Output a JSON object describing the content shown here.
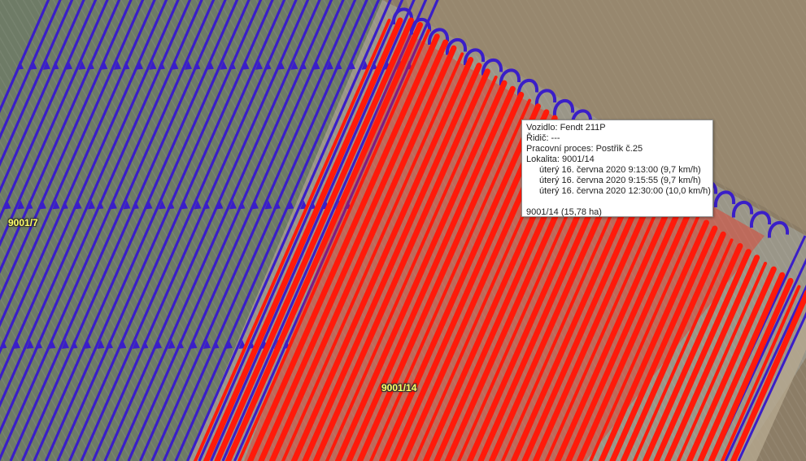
{
  "map": {
    "colors": {
      "left_field": "#6e7b66",
      "right_field": "#9a9688",
      "bare_soil": "#8c7d66",
      "blue_track": "#3a1ec8",
      "red_track": "#ff1a0a"
    }
  },
  "parcels": [
    {
      "label": "9001/7"
    },
    {
      "label": "9001/14"
    }
  ],
  "tooltip": {
    "vehicle": "Vozidlo: Fendt 211P",
    "driver": "Řidič: ---",
    "process": "Pracovní proces: Postřik č.25",
    "location": "Lokalita: 9001/14",
    "times": [
      "úterý 16. června 2020 9:13:00 (9,7 km/h)",
      "úterý 16. června 2020 9:15:55 (9,7 km/h)",
      "úterý 16. června 2020 12:30:00 (10,0 km/h)"
    ],
    "area": "9001/14 (15,78 ha)"
  }
}
